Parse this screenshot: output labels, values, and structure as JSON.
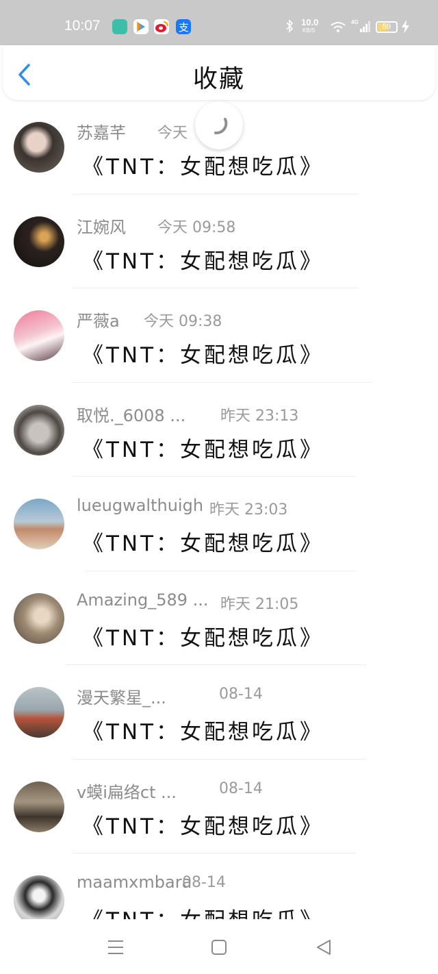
{
  "status_bar": {
    "time": "10:07",
    "net_speed": "10.0",
    "net_unit": "KB/S",
    "signal_label": "4G",
    "battery": "59",
    "battery_level": 0.59,
    "icons": [
      "app-icon-teal",
      "tencent-video-icon",
      "weibo-icon",
      "alipay-icon",
      "bluetooth-icon",
      "wifi-icon",
      "signal-icon",
      "charging-icon"
    ]
  },
  "header": {
    "title": "收藏",
    "back_icon": "chevron-left-icon"
  },
  "items": [
    {
      "name": "苏嘉芊",
      "date": "今天",
      "post": "《TNT：女配想吃瓜》"
    },
    {
      "name": "江婉风",
      "date": "今天 09:58",
      "post": "《TNT：女配想吃瓜》"
    },
    {
      "name": "严薇a",
      "date": "今天 09:38",
      "post": "《TNT：女配想吃瓜》"
    },
    {
      "name": "取悦._6008 ...",
      "date": "昨天 23:13",
      "post": "《TNT：女配想吃瓜》"
    },
    {
      "name": "lueugwalthuigh",
      "date": "昨天 23:03",
      "post": "《TNT：女配想吃瓜》"
    },
    {
      "name": "Amazing_589 ...",
      "date": "昨天 21:05",
      "post": "《TNT：女配想吃瓜》"
    },
    {
      "name": "漫天繁星_...",
      "date": "08-14",
      "post": "《TNT：女配想吃瓜》"
    },
    {
      "name": "v蟆i扁络ct ...",
      "date": "08-14",
      "post": "《TNT：女配想吃瓜》"
    },
    {
      "name": "maamxmbara",
      "date": "08-14",
      "post": "《TNT：女配想吃瓜》"
    }
  ],
  "colors": {
    "status_bar_bg": "#c9c9c9",
    "accent": "#2f8ee8",
    "name_gray": "#8c8c8c",
    "text": "#111111"
  },
  "nav": {
    "icons": [
      "menu-icon",
      "home-square-icon",
      "back-triangle-icon"
    ]
  }
}
